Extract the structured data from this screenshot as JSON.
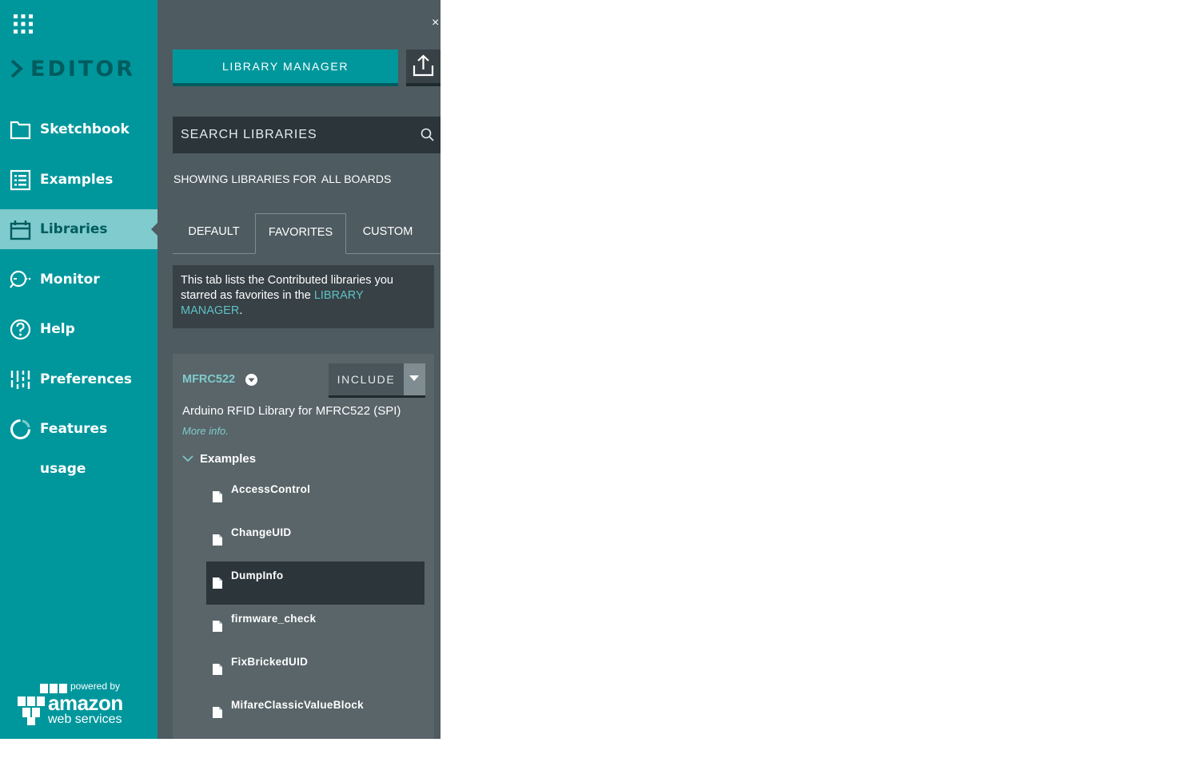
{
  "sidebar": {
    "logo_text": "EDITOR",
    "items": [
      {
        "label": "Sketchbook",
        "icon": "folder-icon"
      },
      {
        "label": "Examples",
        "icon": "list-icon"
      },
      {
        "label": "Libraries",
        "icon": "library-icon"
      },
      {
        "label": "Monitor",
        "icon": "monitor-icon"
      },
      {
        "label": "Help",
        "icon": "help-icon"
      },
      {
        "label": "Preferences",
        "icon": "sliders-icon"
      },
      {
        "label": "Features usage",
        "icon": "usage-icon"
      }
    ],
    "active": "Libraries",
    "aws": {
      "powered": "powered by",
      "amazon": "amazon",
      "web_services": "web services"
    }
  },
  "panel": {
    "close_label": "×",
    "library_manager_label": "LIBRARY MANAGER",
    "search_placeholder": "SEARCH LIBRARIES",
    "showing_prefix": "SHOWING LIBRARIES FOR",
    "showing_boards": "ALL BOARDS",
    "tabs": [
      "DEFAULT",
      "FAVORITES",
      "CUSTOM"
    ],
    "active_tab": "FAVORITES",
    "info_text": "This tab lists the Contributed libraries you starred as favorites in the",
    "info_link": "LIBRARY MANAGER",
    "info_end": "."
  },
  "library": {
    "name": "MFRC522",
    "include_label": "INCLUDE",
    "description": "Arduino RFID Library for MFRC522 (SPI)",
    "more_info": "More info.",
    "examples_label": "Examples",
    "examples": [
      "AccessControl",
      "ChangeUID",
      "DumpInfo",
      "firmware_check",
      "FixBrickedUID",
      "MifareClassicValueBlock"
    ],
    "active_example": "DumpInfo"
  },
  "colors": {
    "teal": "#00979c",
    "dark_teal": "#005c5f",
    "panel": "#4e5b61",
    "light_teal": "#7fcbcd"
  }
}
